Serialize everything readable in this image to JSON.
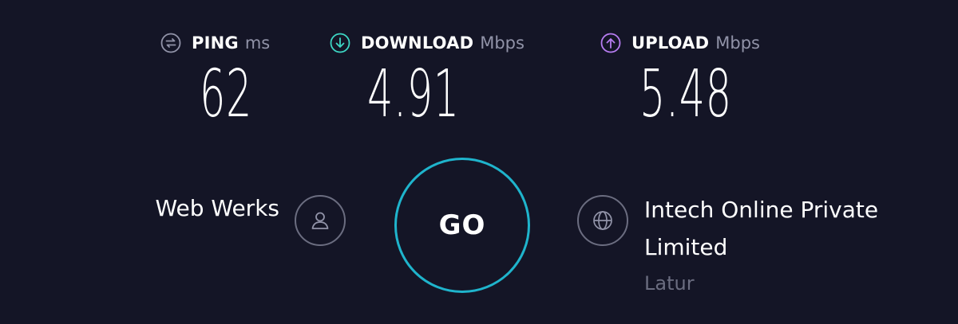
{
  "metrics": {
    "ping": {
      "label": "PING",
      "unit": "ms",
      "value": "62",
      "icon": "ping-icon",
      "icon_color": "#9193a8"
    },
    "download": {
      "label": "DOWNLOAD",
      "unit": "Mbps",
      "value": "4.91",
      "icon": "download-arrow-icon",
      "icon_color": "#3dd6c4"
    },
    "upload": {
      "label": "UPLOAD",
      "unit": "Mbps",
      "value": "5.48",
      "icon": "upload-arrow-icon",
      "icon_color": "#b67cf0"
    }
  },
  "server": {
    "host": "Web Werks",
    "host_icon": "user-icon",
    "isp": "Intech Online Private Limited",
    "isp_icon": "globe-icon",
    "location": "Latur"
  },
  "go_button": {
    "label": "GO",
    "ring_color": "#1fb4cc"
  },
  "colors": {
    "background": "#141526",
    "text": "#ffffff",
    "muted": "#9193a8",
    "dim": "#6b6d80"
  }
}
